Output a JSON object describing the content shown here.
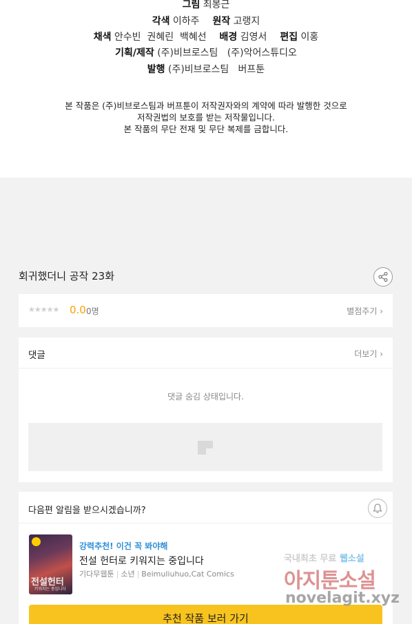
{
  "credits": {
    "line0": {
      "role": "그림",
      "name": "최봉근"
    },
    "line1": {
      "role1": "각색",
      "name1": "이하주",
      "role2": "원작",
      "name2": "고랭지"
    },
    "line2": {
      "role1": "채색",
      "name1": "안수빈  권혜린  백혜선",
      "role2": "배경",
      "name2": "김영서",
      "role3": "편집",
      "name3": "이홍"
    },
    "line3": {
      "role": "기획/제작",
      "name": "(주)비브로스팀   (주)악어스튜디오"
    },
    "line4": {
      "role": "발행",
      "name": "(주)비브로스팀   버프툰"
    },
    "notice": [
      "본 작품은 (주)비브로스팀과 버프툰이 저작권자와의 계약에 따라 발행한 것으로",
      "저작권법의 보호를 받는 저작물입니다.",
      "본 작품의 무단 전재 및 무단 복제를 금합니다."
    ]
  },
  "episode": {
    "title": "회귀했더니 공작 23화",
    "share_icon": "share-icon"
  },
  "rating": {
    "stars_display": "★★★★★",
    "score": "0.0",
    "count": "0명",
    "rate_link": "별점주기 ›"
  },
  "comments": {
    "title": "댓글",
    "more_link": "더보기 ›",
    "hidden_message": "댓글 숨김 상태입니다."
  },
  "alert": {
    "question": "다음편 알림을 받으시겠습니까?",
    "bell_icon": "bell-icon"
  },
  "recommend": {
    "tag": "강력추천! 이건 꼭 봐야해",
    "title": "전설 헌터로 키워지는 중입니다",
    "meta": [
      "기다무웹툰",
      "소년",
      "Beimuliuhuo,Cat Comics"
    ],
    "thumb_title": "전설헌터",
    "thumb_sub": "키워지는 중입니다",
    "button": "추천 작품 보러 가기",
    "button_color": "#f8c31e",
    "tag_color": "#2f8fd8"
  },
  "watermark": {
    "line1_a": "국내최초 무료",
    "line1_b": "웹소설",
    "line2": "아지툰소설",
    "line3": "novelagit.xyz"
  }
}
